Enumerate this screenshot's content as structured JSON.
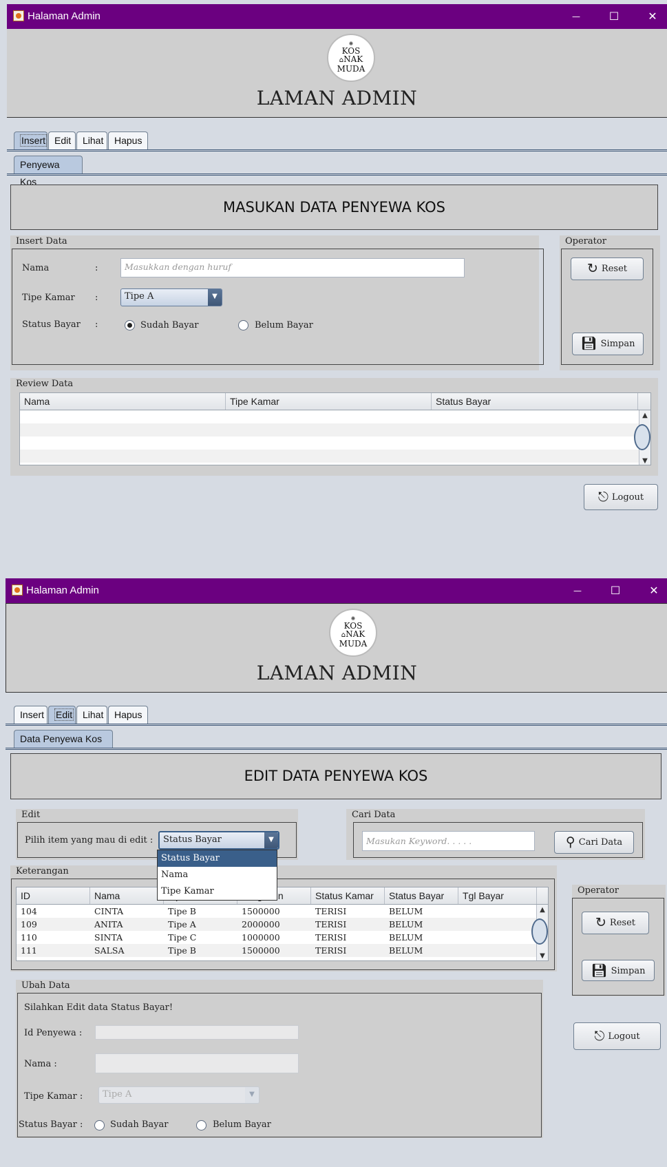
{
  "window_title": "Halaman Admin",
  "controls": {
    "minimize": "—",
    "maximize": "☐",
    "close": "✕"
  },
  "logo": {
    "line1": "KOS",
    "line2": "NAK",
    "line3": "MUDA"
  },
  "header_title": "LAMAN ADMIN",
  "main_tabs": [
    "Insert",
    "Edit",
    "Lihat",
    "Hapus"
  ],
  "insert": {
    "subtab": "Penyewa Kos",
    "banner": "MASUKAN DATA PENYEWA KOS",
    "insert_group_title": "Insert Data",
    "nama_label": "Nama",
    "tipe_label": "Tipe Kamar",
    "status_label": "Status Bayar",
    "colon": ":",
    "nama_placeholder": "Masukkan dengan huruf",
    "tipe_value": "Tipe A",
    "radio_sudah": "Sudah Bayar",
    "radio_belum": "Belum Bayar",
    "operator_title": "Operator",
    "reset_label": "Reset",
    "simpan_label": "Simpan",
    "review_title": "Review Data",
    "review_columns": [
      "Nama",
      "Tipe Kamar",
      "Status Bayar"
    ],
    "logout_label": "Logout"
  },
  "edit": {
    "subtab": "Data Penyewa Kos",
    "banner": "EDIT DATA PENYEWA KOS",
    "edit_group_title": "Edit",
    "pilih_label": "Pilih item yang mau di edit :",
    "combo_value": "Status Bayar",
    "dropdown_options": [
      "Status Bayar",
      "Nama",
      "Tipe Kamar"
    ],
    "cari_title": "Cari Data",
    "cari_placeholder": "Masukan Keyword. . . . .",
    "cari_button": "Cari Data",
    "keterangan_title": "Keterangan",
    "columns": [
      "ID",
      "Nama",
      "Tipe",
      "Harga/bln",
      "Status Kamar",
      "Status Bayar",
      "Tgl Bayar"
    ],
    "rows": [
      [
        "104",
        "CINTA",
        "Tipe B",
        "1500000",
        "TERISI",
        "BELUM",
        ""
      ],
      [
        "109",
        "ANITA",
        "Tipe A",
        "2000000",
        "TERISI",
        "BELUM",
        ""
      ],
      [
        "110",
        "SINTA",
        "Tipe C",
        "1000000",
        "TERISI",
        "BELUM",
        ""
      ],
      [
        "111",
        "SALSA",
        "Tipe B",
        "1500000",
        "TERISI",
        "BELUM",
        ""
      ]
    ],
    "operator_title": "Operator",
    "reset_label": "Reset",
    "simpan_label": "Simpan",
    "logout_label": "Logout",
    "ubah_title": "Ubah  Data",
    "ubah_hint": "Silahkan Edit data Status Bayar!",
    "id_label": "Id Penyewa :",
    "nama_label": "Nama :",
    "tipe_label": "Tipe Kamar :",
    "tipe_value": "Tipe A",
    "status_label": "Status Bayar :",
    "radio_sudah": "Sudah Bayar",
    "radio_belum": "Belum Bayar"
  }
}
